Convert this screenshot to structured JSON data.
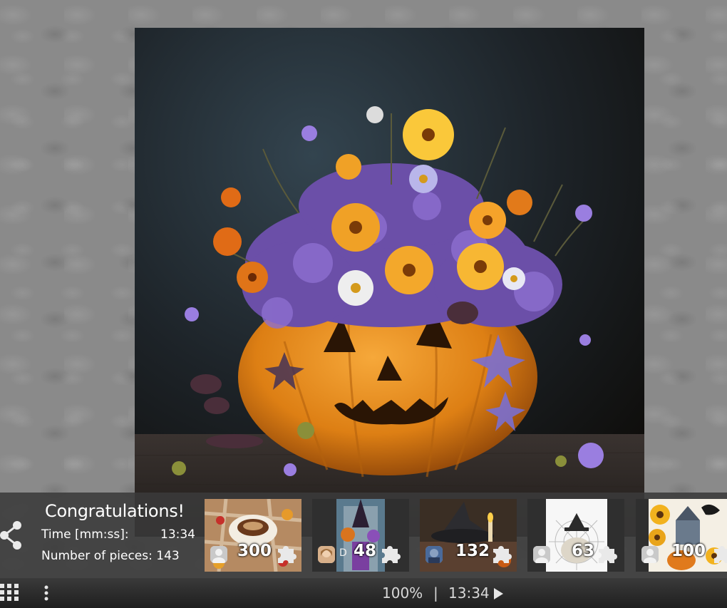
{
  "result": {
    "title": "Congratulations!",
    "time_label": "Time [mm:ss]:",
    "time_value": "13:34",
    "pieces_label": "Number of pieces:",
    "pieces_value": "143"
  },
  "suggestions": [
    {
      "pieces": "300",
      "theme": "coffee-cup-autumn",
      "user_initial": ""
    },
    {
      "pieces": "48",
      "theme": "witch-door",
      "user_initial": "D"
    },
    {
      "pieces": "132",
      "theme": "witch-hat-candle",
      "user_initial": ""
    },
    {
      "pieces": "63",
      "theme": "pumpkin-spiderweb",
      "user_initial": ""
    },
    {
      "pieces": "100",
      "theme": "sunflowers-castle-crow",
      "user_initial": ""
    }
  ],
  "toolbar": {
    "zoom": "100%",
    "separator": "|",
    "timer": "13:34"
  },
  "icons": {
    "share": "share-icon",
    "grid": "grid-icon",
    "menu": "more-vertical-icon",
    "play": "play-icon",
    "piece": "puzzle-piece-icon"
  },
  "colors": {
    "bar_bg": "#3a3a3a",
    "text": "#ffffff",
    "pumpkin": "#e08a1e"
  }
}
